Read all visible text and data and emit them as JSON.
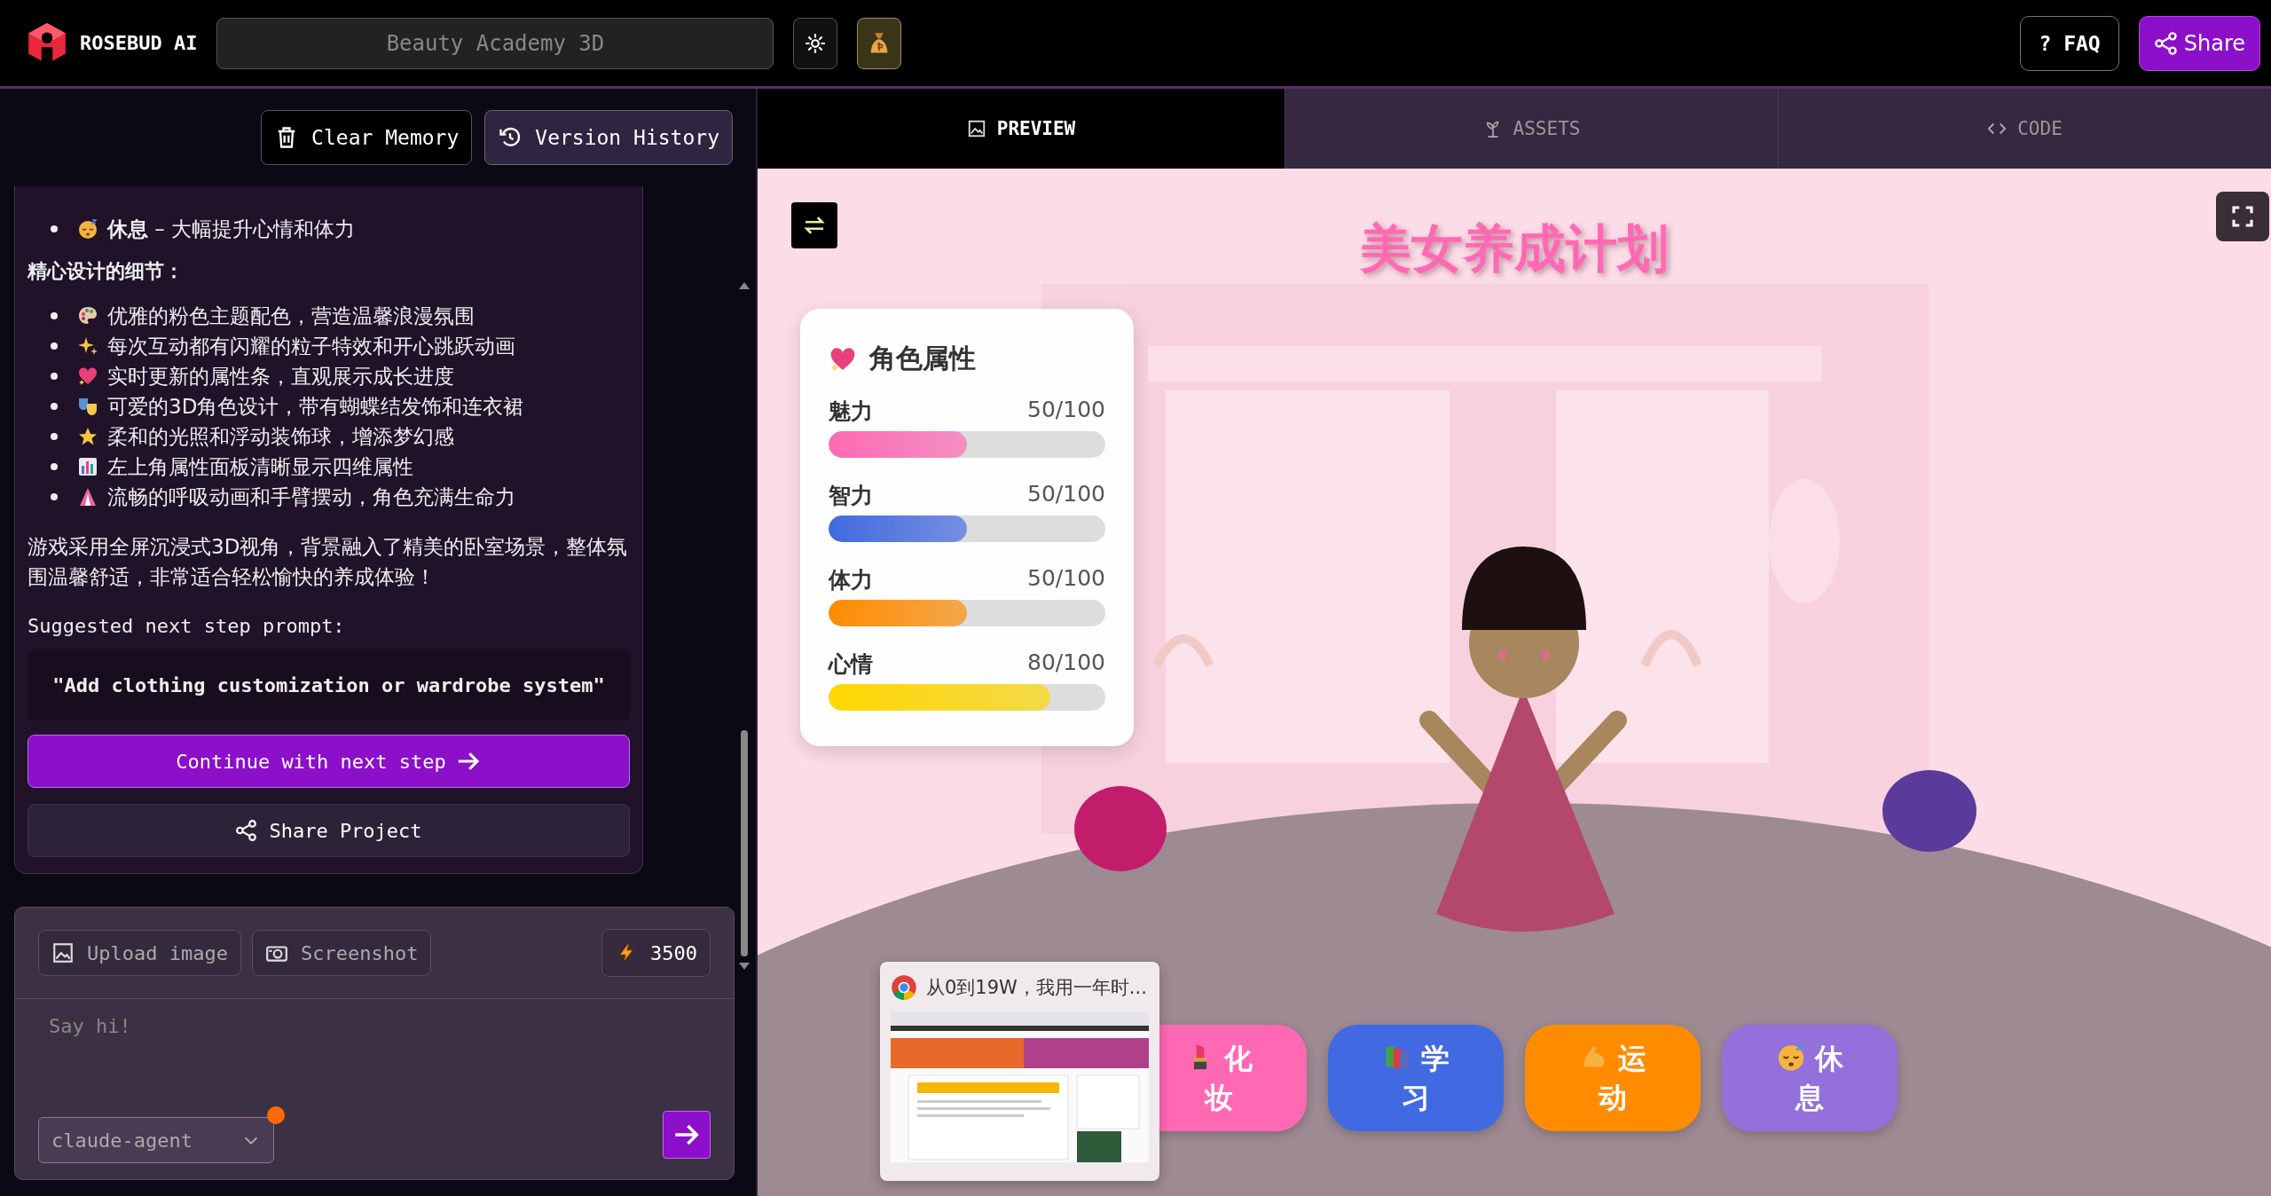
{
  "app": {
    "brand": "ROSEBUD AI",
    "project_name": "Beauty Academy 3D",
    "faq": "? FAQ",
    "share": "Share"
  },
  "memory_bar": {
    "buttons": [
      {
        "label": "Clear Memory",
        "kind": "trash",
        "selected": false
      },
      {
        "label": "Version History",
        "kind": "history",
        "selected": true
      }
    ]
  },
  "chat": {
    "cut_item": {
      "kind": "sleepy",
      "text": "**休息** – 大幅提升心情和体力"
    },
    "heading": "精心设计的细节：",
    "details": [
      {
        "kind": "palette",
        "text": "优雅的粉色主题配色，营造温馨浪漫氛围"
      },
      {
        "kind": "sparkles",
        "text": "每次互动都有闪耀的粒子特效和开心跳跃动画"
      },
      {
        "kind": "heart",
        "text": "实时更新的属性条，直观展示成长进度"
      },
      {
        "kind": "masks",
        "text": "可爱的3D角色设计，带有蝴蝶结发饰和连衣裙"
      },
      {
        "kind": "star",
        "text": "柔和的光照和浮动装饰球，增添梦幻感"
      },
      {
        "kind": "chart",
        "text": "左上角属性面板清晰显示四维属性"
      },
      {
        "kind": "tent",
        "text": "流畅的呼吸动画和手臂摆动，角色充满生命力"
      }
    ],
    "summary": "游戏采用全屏沉浸式3D视角，背景融入了精美的卧室场景，整体氛围温馨舒适，非常适合轻松愉快的养成体验！",
    "suggest_label": "Suggested next step prompt:",
    "suggestion": "\"Add clothing customization or wardrobe system\"",
    "continue": "Continue with next step",
    "share_project": "Share Project"
  },
  "composer": {
    "tools": [
      {
        "label": "Upload image",
        "kind": "image"
      },
      {
        "label": "Screenshot",
        "kind": "camera"
      }
    ],
    "credits": "3500",
    "placeholder": "Say hi!",
    "model": "claude-agent",
    "model_alert": true
  },
  "tabs": [
    {
      "label": "PREVIEW",
      "kind": "image",
      "selected": true
    },
    {
      "label": "ASSETS",
      "kind": "plant",
      "selected": false
    },
    {
      "label": "CODE",
      "kind": "code",
      "selected": false
    }
  ],
  "game": {
    "title": "美女养成计划",
    "panel_title": "角色属性",
    "stats": [
      {
        "name": "魅力",
        "value": "50/100",
        "level": 0.5,
        "color": "#ff69b4"
      },
      {
        "name": "智力",
        "value": "50/100",
        "level": 0.5,
        "color": "#4169e1"
      },
      {
        "name": "体力",
        "value": "50/100",
        "level": 0.5,
        "color": "#ff8c00"
      },
      {
        "name": "心情",
        "value": "80/100",
        "level": 0.8,
        "color": "#ffd700"
      }
    ],
    "actions": [
      {
        "kind": "lipstick",
        "label": "化妆",
        "color": "#ff69b4"
      },
      {
        "kind": "books",
        "label": "学习",
        "color": "#4169e1"
      },
      {
        "kind": "arm",
        "label": "运动",
        "color": "#ff8c00"
      },
      {
        "kind": "sleepy",
        "label": "休息",
        "color": "#9370db"
      }
    ]
  },
  "popup": {
    "title": "从0到19W，我用一年时..."
  }
}
